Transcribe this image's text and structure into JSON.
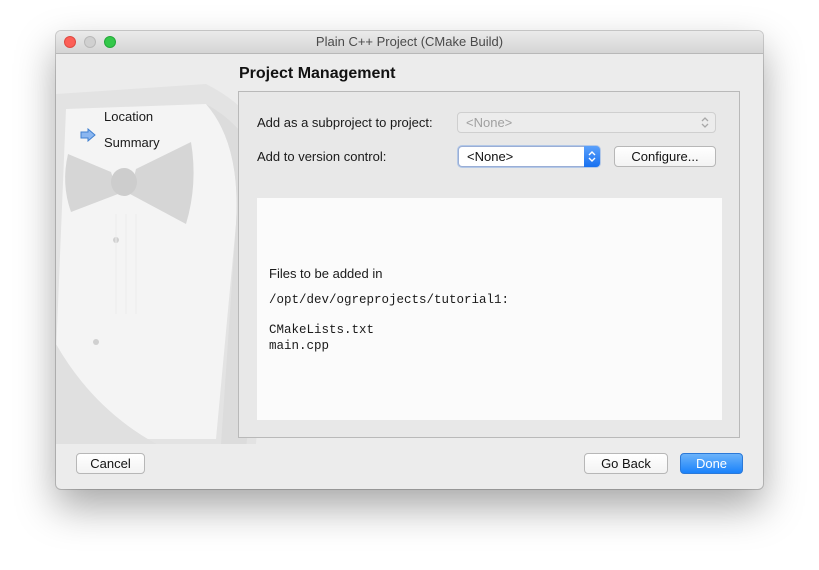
{
  "window": {
    "title": "Plain C++ Project (CMake Build)"
  },
  "sidebar": {
    "steps": [
      {
        "label": "Location",
        "current": false
      },
      {
        "label": "Summary",
        "current": true
      }
    ]
  },
  "main": {
    "title": "Project Management",
    "subproject": {
      "label": "Add as a subproject to project:",
      "value": "<None>",
      "enabled": false
    },
    "version_control": {
      "label": "Add to version control:",
      "value": "<None>"
    },
    "configure_label": "Configure...",
    "summary": {
      "heading": "Files to be added in",
      "path": "/opt/dev/ogreprojects/tutorial1:",
      "files": [
        "CMakeLists.txt",
        "main.cpp"
      ]
    }
  },
  "footer": {
    "cancel_label": "Cancel",
    "back_label": "Go Back",
    "done_label": "Done"
  },
  "colors": {
    "accent": "#1a82fb",
    "close": "#fc5f57",
    "maximize": "#34c84a",
    "window_bg": "#ececec"
  }
}
